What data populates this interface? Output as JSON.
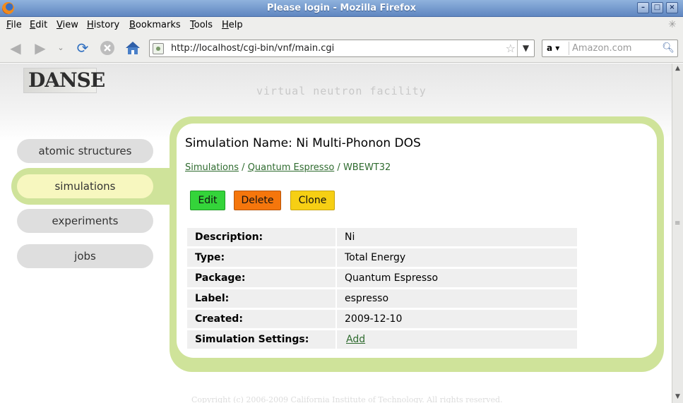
{
  "window": {
    "title": "Please login - Mozilla Firefox",
    "controls": {
      "minimize": "–",
      "maximize": "□",
      "close": "×"
    }
  },
  "menu": {
    "items": [
      {
        "key": "F",
        "rest": "ile"
      },
      {
        "key": "E",
        "rest": "dit"
      },
      {
        "key": "V",
        "rest": "iew"
      },
      {
        "key": "H",
        "rest": "istory"
      },
      {
        "key": "B",
        "rest": "ookmarks"
      },
      {
        "key": "T",
        "rest": "ools"
      },
      {
        "key": "H",
        "rest": "elp"
      }
    ]
  },
  "toolbar": {
    "url": "http://localhost/cgi-bin/vnf/main.cgi",
    "search_engine": "a",
    "search_placeholder": "Amazon.com",
    "icons": [
      "back-icon",
      "forward-icon",
      "history-dropdown-icon",
      "reload-icon",
      "stop-icon",
      "home-icon"
    ]
  },
  "header": {
    "logo_text": "DANSE",
    "tagline": "virtual neutron facility"
  },
  "sidebar": {
    "items": [
      {
        "label": "atomic structures",
        "active": false
      },
      {
        "label": "simulations",
        "active": true
      },
      {
        "label": "experiments",
        "active": false
      },
      {
        "label": "jobs",
        "active": false
      }
    ]
  },
  "main": {
    "title": "Simulation Name: Ni Multi-Phonon DOS",
    "breadcrumb": {
      "link1": "Simulations",
      "sep1": " / ",
      "link2": "Quantum Espresso",
      "sep2": " / ",
      "current": "WBEWT32"
    },
    "actions": {
      "edit": "Edit",
      "delete": "Delete",
      "clone": "Clone"
    },
    "details": [
      {
        "key": "Description:",
        "value": "Ni"
      },
      {
        "key": "Type:",
        "value": "Total Energy"
      },
      {
        "key": "Package:",
        "value": "Quantum Espresso"
      },
      {
        "key": "Label:",
        "value": "espresso"
      },
      {
        "key": "Created:",
        "value": "2009-12-10"
      },
      {
        "key": "Simulation Settings:",
        "link": "Add"
      }
    ]
  },
  "footer": {
    "text": "Copyright (c) 2006-2009 California Institute of Technology. All rights reserved."
  },
  "colors": {
    "panel_green": "#cfe39a",
    "active_pill": "#f7f7bf",
    "edit": "#34d43a",
    "delete": "#f5760c",
    "clone": "#f6cf14",
    "link": "#2f6b2f"
  }
}
